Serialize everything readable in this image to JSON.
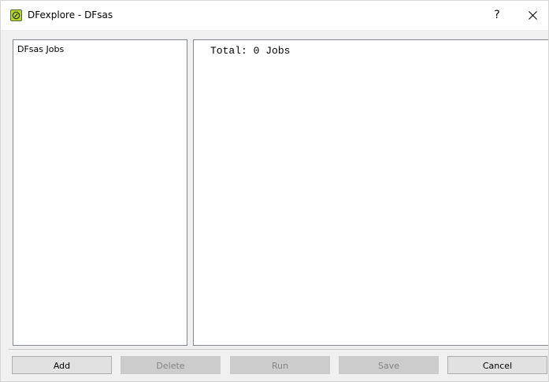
{
  "window": {
    "title": "DFexplore - DFsas",
    "icon": "dfexplore-app-icon",
    "help_label": "?",
    "close_icon": "close-icon"
  },
  "jobs_list": {
    "header": "DFsas Jobs",
    "items": []
  },
  "output": {
    "text": "Total: 0 Jobs"
  },
  "buttons": {
    "add": {
      "label": "Add",
      "enabled": true
    },
    "delete": {
      "label": "Delete",
      "enabled": false
    },
    "run": {
      "label": "Run",
      "enabled": false
    },
    "save": {
      "label": "Save",
      "enabled": false
    },
    "cancel": {
      "label": "Cancel",
      "enabled": true
    }
  },
  "colors": {
    "app_icon": "#b5d334",
    "disabled_button": "#cccccc",
    "button": "#e1e1e1"
  }
}
